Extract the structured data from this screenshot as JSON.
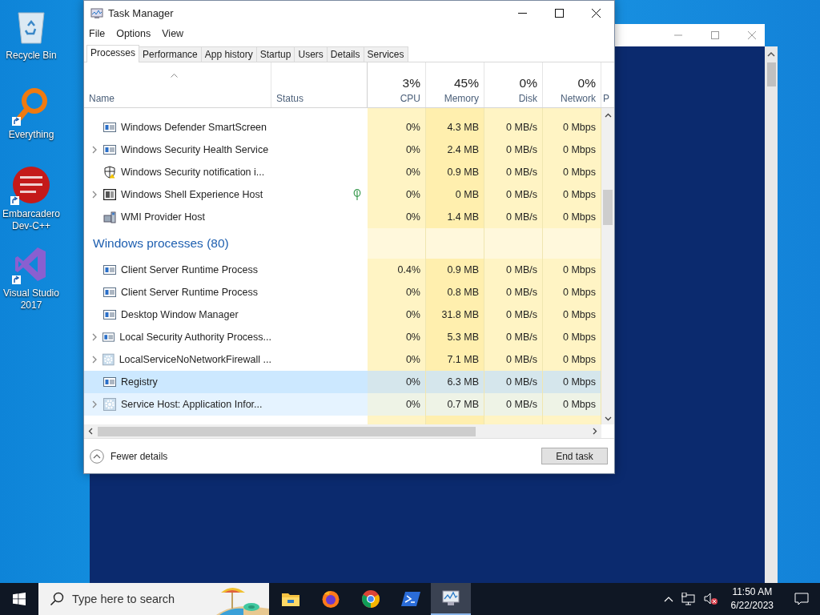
{
  "desktop_icons": [
    {
      "label": "Recycle Bin",
      "kind": "recycle",
      "shortcut": false
    },
    {
      "label": "Everything",
      "kind": "everything",
      "shortcut": true
    },
    {
      "label": "Embarcadero Dev-C++",
      "kind": "devcpp",
      "shortcut": true
    },
    {
      "label": "Visual Studio 2017",
      "kind": "vs",
      "shortcut": true
    }
  ],
  "window": {
    "title": "Task Manager",
    "menu": [
      "File",
      "Options",
      "View"
    ],
    "tabs": [
      {
        "label": "Processes",
        "selected": true
      },
      {
        "label": "Performance",
        "selected": false
      },
      {
        "label": "App history",
        "selected": false
      },
      {
        "label": "Startup",
        "selected": false
      },
      {
        "label": "Users",
        "selected": false
      },
      {
        "label": "Details",
        "selected": false
      },
      {
        "label": "Services",
        "selected": false
      }
    ],
    "columns": [
      {
        "label": "Name",
        "kind": "name"
      },
      {
        "label": "Status",
        "kind": "text"
      },
      {
        "label": "CPU",
        "summary": "3%",
        "kind": "metric"
      },
      {
        "label": "Memory",
        "summary": "45%",
        "kind": "metric"
      },
      {
        "label": "Disk",
        "summary": "0%",
        "kind": "metric"
      },
      {
        "label": "Network",
        "summary": "0%",
        "kind": "metric"
      },
      {
        "label": "P",
        "kind": "cut"
      }
    ],
    "rows": [
      {
        "kind": "app",
        "name": "Windows Defender SmartScreen",
        "expandable": false,
        "eco": false,
        "selected": false,
        "hovered": false,
        "cpu": "0%",
        "memory": "4.3 MB",
        "disk": "0 MB/s",
        "network": "0 Mbps"
      },
      {
        "kind": "app",
        "name": "Windows Security Health Service",
        "expandable": true,
        "eco": false,
        "selected": false,
        "hovered": false,
        "cpu": "0%",
        "memory": "2.4 MB",
        "disk": "0 MB/s",
        "network": "0 Mbps"
      },
      {
        "kind": "shield",
        "name": "Windows Security notification i...",
        "expandable": false,
        "eco": false,
        "selected": false,
        "hovered": false,
        "cpu": "0%",
        "memory": "0.9 MB",
        "disk": "0 MB/s",
        "network": "0 Mbps"
      },
      {
        "kind": "shell",
        "name": "Windows Shell Experience Host",
        "expandable": true,
        "eco": true,
        "selected": false,
        "hovered": false,
        "cpu": "0%",
        "memory": "0 MB",
        "disk": "0 MB/s",
        "network": "0 Mbps"
      },
      {
        "kind": "wmi",
        "name": "WMI Provider Host",
        "expandable": false,
        "eco": false,
        "selected": false,
        "hovered": false,
        "cpu": "0%",
        "memory": "1.4 MB",
        "disk": "0 MB/s",
        "network": "0 Mbps"
      },
      {
        "kind": "group",
        "name": "Windows processes (80)"
      },
      {
        "kind": "app",
        "name": "Client Server Runtime Process",
        "expandable": false,
        "eco": false,
        "selected": false,
        "hovered": false,
        "cpu": "0.4%",
        "memory": "0.9 MB",
        "disk": "0 MB/s",
        "network": "0 Mbps"
      },
      {
        "kind": "app",
        "name": "Client Server Runtime Process",
        "expandable": false,
        "eco": false,
        "selected": false,
        "hovered": false,
        "cpu": "0%",
        "memory": "0.8 MB",
        "disk": "0 MB/s",
        "network": "0 Mbps"
      },
      {
        "kind": "app",
        "name": "Desktop Window Manager",
        "expandable": false,
        "eco": false,
        "selected": false,
        "hovered": false,
        "cpu": "0%",
        "memory": "31.8 MB",
        "disk": "0 MB/s",
        "network": "0 Mbps"
      },
      {
        "kind": "app",
        "name": "Local Security Authority Process...",
        "expandable": true,
        "eco": false,
        "selected": false,
        "hovered": false,
        "cpu": "0%",
        "memory": "5.3 MB",
        "disk": "0 MB/s",
        "network": "0 Mbps"
      },
      {
        "kind": "gear",
        "name": "LocalServiceNoNetworkFirewall ...",
        "expandable": true,
        "eco": false,
        "selected": false,
        "hovered": false,
        "cpu": "0%",
        "memory": "7.1 MB",
        "disk": "0 MB/s",
        "network": "0 Mbps"
      },
      {
        "kind": "app",
        "name": "Registry",
        "expandable": false,
        "eco": false,
        "selected": true,
        "hovered": false,
        "cpu": "0%",
        "memory": "6.3 MB",
        "disk": "0 MB/s",
        "network": "0 Mbps"
      },
      {
        "kind": "gear",
        "name": "Service Host: Application Infor...",
        "expandable": true,
        "eco": false,
        "selected": false,
        "hovered": true,
        "cpu": "0%",
        "memory": "0.7 MB",
        "disk": "0 MB/s",
        "network": "0 Mbps"
      }
    ],
    "footer": {
      "toggle": "Fewer details",
      "button": "End task"
    }
  },
  "taskbar": {
    "search": {
      "placeholder": "Type here to search"
    },
    "apps": [
      {
        "kind": "explorer",
        "active": false
      },
      {
        "kind": "firefox",
        "active": false
      },
      {
        "kind": "chrome",
        "active": false
      },
      {
        "kind": "powershell",
        "active": false
      },
      {
        "kind": "taskmgr",
        "active": true
      }
    ],
    "volume_muted": true,
    "time": "11:50 AM",
    "date": "6/22/2023"
  }
}
